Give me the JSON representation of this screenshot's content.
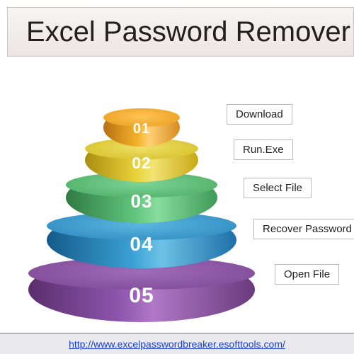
{
  "title": "Excel Password Remover",
  "pyramid": {
    "levels": [
      {
        "num": "01",
        "rim": "#d88a1f",
        "cap": "#f5b32a"
      },
      {
        "num": "02",
        "rim": "#c7a917",
        "cap": "#e8d23a"
      },
      {
        "num": "03",
        "rim": "#3f9a56",
        "cap": "#5fc47b"
      },
      {
        "num": "04",
        "rim": "#1f6fa8",
        "cap": "#3aa0d4"
      },
      {
        "num": "05",
        "rim": "#6a3a7e",
        "cap": "#8d55ac"
      }
    ]
  },
  "steps": [
    {
      "label": "Download"
    },
    {
      "label": "Run.Exe"
    },
    {
      "label": "Select File"
    },
    {
      "label": "Recover Password"
    },
    {
      "label": "Open File"
    }
  ],
  "footer": {
    "url_text": "http://www.excelpasswordbreaker.esofttools.com/"
  }
}
